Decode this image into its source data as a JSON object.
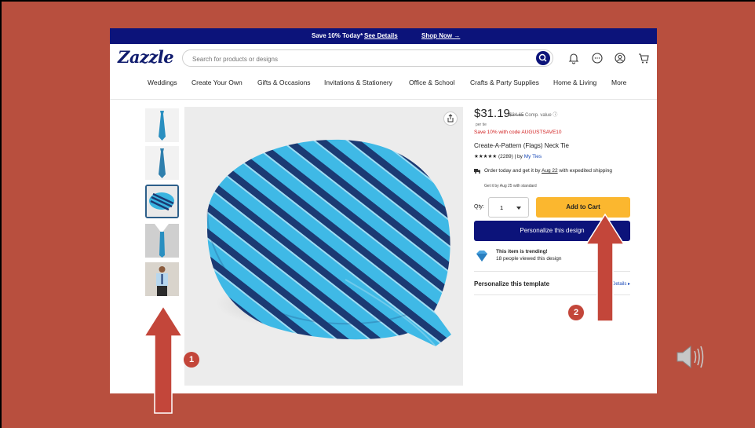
{
  "promo_bar": {
    "text": "Save 10% Today*",
    "details_link": "See Details",
    "shop_now": "Shop Now →"
  },
  "header": {
    "logo": "Zazzle",
    "search_placeholder": "Search for products or designs",
    "icons": [
      "search-icon",
      "bell-icon",
      "chat-icon",
      "account-icon",
      "cart-icon"
    ]
  },
  "nav": {
    "items": [
      "Weddings",
      "Create Your Own",
      "Gifts & Occasions",
      "Invitations & Stationery",
      "Office & School",
      "Crafts & Party Supplies",
      "Home & Living",
      "More"
    ]
  },
  "product": {
    "price": "$31.19",
    "comp_price": "$34.65",
    "comp_label": "Comp. value ⓘ",
    "per_unit": "per tie",
    "promo_code_text": "Save 10% with code AUGUSTSAVE10",
    "title": "Create-A-Pattern (Flags) Neck Tie",
    "stars": "★★★★★",
    "rating_count": "(2289) | by",
    "store": "My Ties",
    "shipping_prefix": "Order today and get it by",
    "shipping_date": "Aug 22",
    "shipping_suffix": "with expedited shipping",
    "shipping_standard": "Get it by Aug 25 with standard",
    "qty_label": "Qty:",
    "qty_value": "1",
    "add_to_cart": "Add to Cart",
    "personalize_button": "Personalize this design",
    "trending_title": "This item is trending!",
    "trending_sub": "18 people viewed this design",
    "personalize_template": "Personalize this template",
    "details_link": "Details ▸"
  },
  "annotations": {
    "badge_1": "1",
    "badge_2": "2"
  },
  "colors": {
    "slide_background": "#b84f3e",
    "brand_navy": "#0c137a",
    "add_to_cart": "#fbb72f",
    "tie_light_blue": "#39b4e0",
    "tie_dark_blue": "#1b3a73",
    "arrow": "#c3463a"
  }
}
